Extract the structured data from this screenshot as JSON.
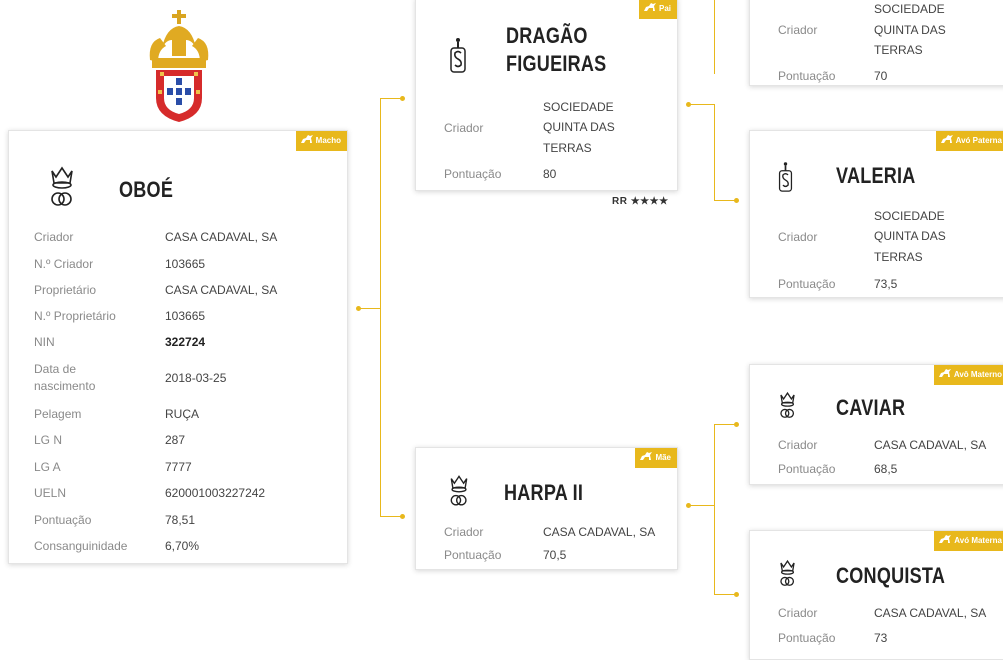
{
  "colors": {
    "accent": "#e8b81c",
    "label": "#8a8a8a",
    "value": "#444444",
    "border": "#e4e4e4"
  },
  "icons": {
    "coat_of_arms": "coat-of-arms-icon",
    "horse": "horse-icon",
    "breeder_logo_s": "s-brand-logo-icon",
    "breeder_logo_crown": "crown-cg-logo-icon"
  },
  "main": {
    "badge": "Macho",
    "name": "OBOÉ",
    "fields": [
      {
        "label": "Criador",
        "value": "CASA CADAVAL, SA"
      },
      {
        "label": "N.º Criador",
        "value": "103665"
      },
      {
        "label": "Proprietário",
        "value": "CASA CADAVAL, SA"
      },
      {
        "label": "N.º Proprietário",
        "value": "103665"
      },
      {
        "label": "NIN",
        "value": "322724"
      },
      {
        "label": "Data de nascimento",
        "value": "2018-03-25"
      },
      {
        "label": "Pelagem",
        "value": "RUÇA"
      },
      {
        "label": "LG N",
        "value": "287"
      },
      {
        "label": "LG A",
        "value": "7777"
      },
      {
        "label": "UELN",
        "value": "620001003227242"
      },
      {
        "label": "Pontuação",
        "value": "78,51"
      },
      {
        "label": "Consanguinidade",
        "value": "6,70%"
      }
    ]
  },
  "sire": {
    "badge": "Pai",
    "name_line1": "DRAGÃO",
    "name_line2": "FIGUEIRAS",
    "criador_label": "Criador",
    "criador_line1": "SOCIEDADE",
    "criador_line2": "QUINTA DAS",
    "criador_line3": "TERRAS",
    "score_label": "Pontuação",
    "score": "80",
    "rating": "RR ★★★★"
  },
  "dam": {
    "badge": "Mãe",
    "name": "HARPA II",
    "criador_label": "Criador",
    "criador": "CASA CADAVAL, SA",
    "score_label": "Pontuação",
    "score": "70,5"
  },
  "pat_grandsire": {
    "criador_label": "Criador",
    "criador_line1": "SOCIEDADE",
    "criador_line2": "QUINTA DAS",
    "criador_line3": "TERRAS",
    "score_label": "Pontuação",
    "score": "70"
  },
  "pat_granddam": {
    "badge": "Avó Paterna",
    "name": "VALERIA",
    "criador_label": "Criador",
    "criador_line1": "SOCIEDADE",
    "criador_line2": "QUINTA DAS",
    "criador_line3": "TERRAS",
    "score_label": "Pontuação",
    "score": "73,5"
  },
  "mat_grandsire": {
    "badge": "Avô Materno",
    "name": "CAVIAR",
    "criador_label": "Criador",
    "criador": "CASA CADAVAL, SA",
    "score_label": "Pontuação",
    "score": "68,5"
  },
  "mat_granddam": {
    "badge": "Avó Materna",
    "name": "CONQUISTA",
    "criador_label": "Criador",
    "criador": "CASA CADAVAL, SA",
    "score_label": "Pontuação",
    "score": "73"
  }
}
